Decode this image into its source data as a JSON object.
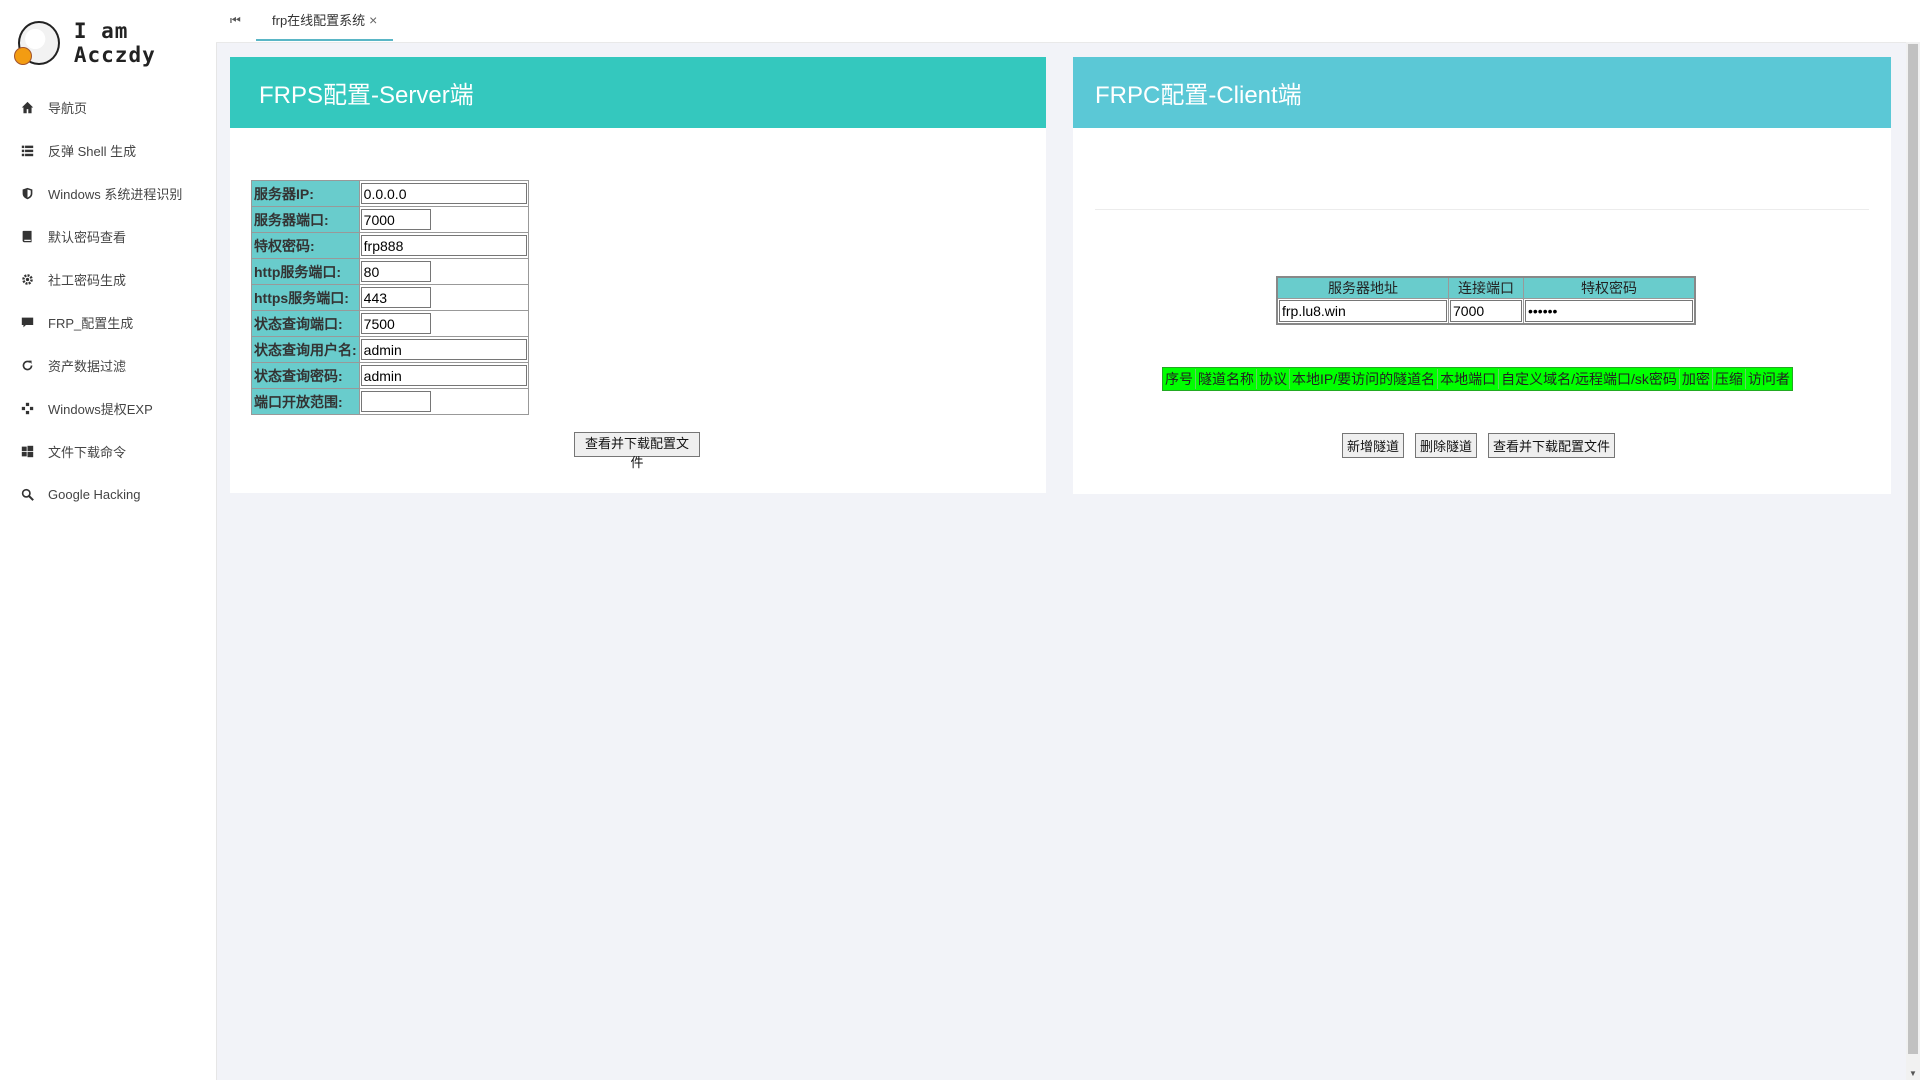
{
  "brand": {
    "title": "I am Acczdy"
  },
  "sidebar": {
    "items": [
      {
        "label": "导航页",
        "icon": "home-icon"
      },
      {
        "label": "反弹 Shell 生成",
        "icon": "list-icon"
      },
      {
        "label": "Windows 系统进程识别",
        "icon": "shield-icon"
      },
      {
        "label": "默认密码查看",
        "icon": "book-icon"
      },
      {
        "label": "社工密码生成",
        "icon": "gear-icon"
      },
      {
        "label": "FRP_配置生成",
        "icon": "comment-icon"
      },
      {
        "label": "资产数据过滤",
        "icon": "refresh-icon"
      },
      {
        "label": "Windows提权EXP",
        "icon": "network-icon"
      },
      {
        "label": "文件下载命令",
        "icon": "windows-icon"
      },
      {
        "label": "Google Hacking",
        "icon": "search-icon"
      }
    ]
  },
  "tabs": {
    "first_icon": "⏮",
    "active_label": "frp在线配置系统",
    "close_symbol": "×"
  },
  "server": {
    "title": "FRPS配置-Server端",
    "fields": [
      {
        "label": "服务器IP:",
        "value": "0.0.0.0",
        "width": "long"
      },
      {
        "label": "服务器端口:",
        "value": "7000",
        "width": "short"
      },
      {
        "label": "特权密码:",
        "value": "frp888",
        "width": "long"
      },
      {
        "label": "http服务端口:",
        "value": "80",
        "width": "short"
      },
      {
        "label": "https服务端口:",
        "value": "443",
        "width": "short"
      },
      {
        "label": "状态查询端口:",
        "value": "7500",
        "width": "short"
      },
      {
        "label": "状态查询用户名:",
        "value": "admin",
        "width": "long"
      },
      {
        "label": "状态查询密码:",
        "value": "admin",
        "width": "long"
      },
      {
        "label": "端口开放范围:",
        "value": "",
        "width": "short"
      }
    ],
    "button_label": "查看并下载配置文件"
  },
  "client": {
    "title": "FRPC配置-Client端",
    "columns": [
      "服务器地址",
      "连接端口",
      "特权密码"
    ],
    "server_addr": "frp.lu8.win",
    "port": "7000",
    "password": "••••••",
    "tunnel_columns": [
      "序号",
      "隧道名称",
      "协议",
      "本地IP/要访问的隧道名",
      "本地端口",
      "自定义域名/远程端口/sk密码",
      "加密",
      "压缩",
      "访问者"
    ],
    "buttons": {
      "add": "新增隧道",
      "delete": "删除隧道",
      "download": "查看并下载配置文件"
    }
  }
}
